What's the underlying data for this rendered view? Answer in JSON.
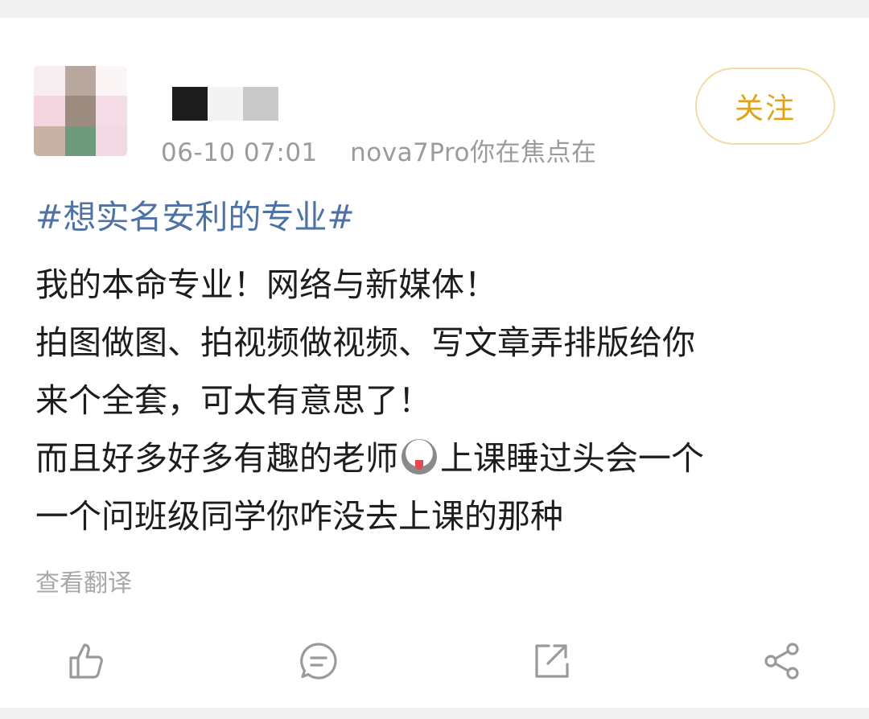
{
  "post": {
    "meta": {
      "time": "06-10 07:01",
      "device": "nova7Pro你在焦点在"
    },
    "follow_label": "关注",
    "topic": "#想实名安利的专业#",
    "body_lines": [
      "我的本命专业！网络与新媒体！",
      "拍图做图、拍视频做视频、写文章弄排版给你",
      "来个全套，可太有意思了！",
      "而且好多好多有趣的老师",
      "上课睡过头会一个",
      "一个问班级同学你咋没去上课的那种"
    ],
    "translate_label": "查看翻译"
  },
  "actions": {
    "like_icon": "thumbs-up-icon",
    "comment_icon": "comment-icon",
    "repost_icon": "share-external-icon",
    "share_icon": "share-nodes-icon"
  },
  "colors": {
    "topic": "#4f72a6",
    "follow": "#e0a21a",
    "meta": "#9b9b9b"
  }
}
